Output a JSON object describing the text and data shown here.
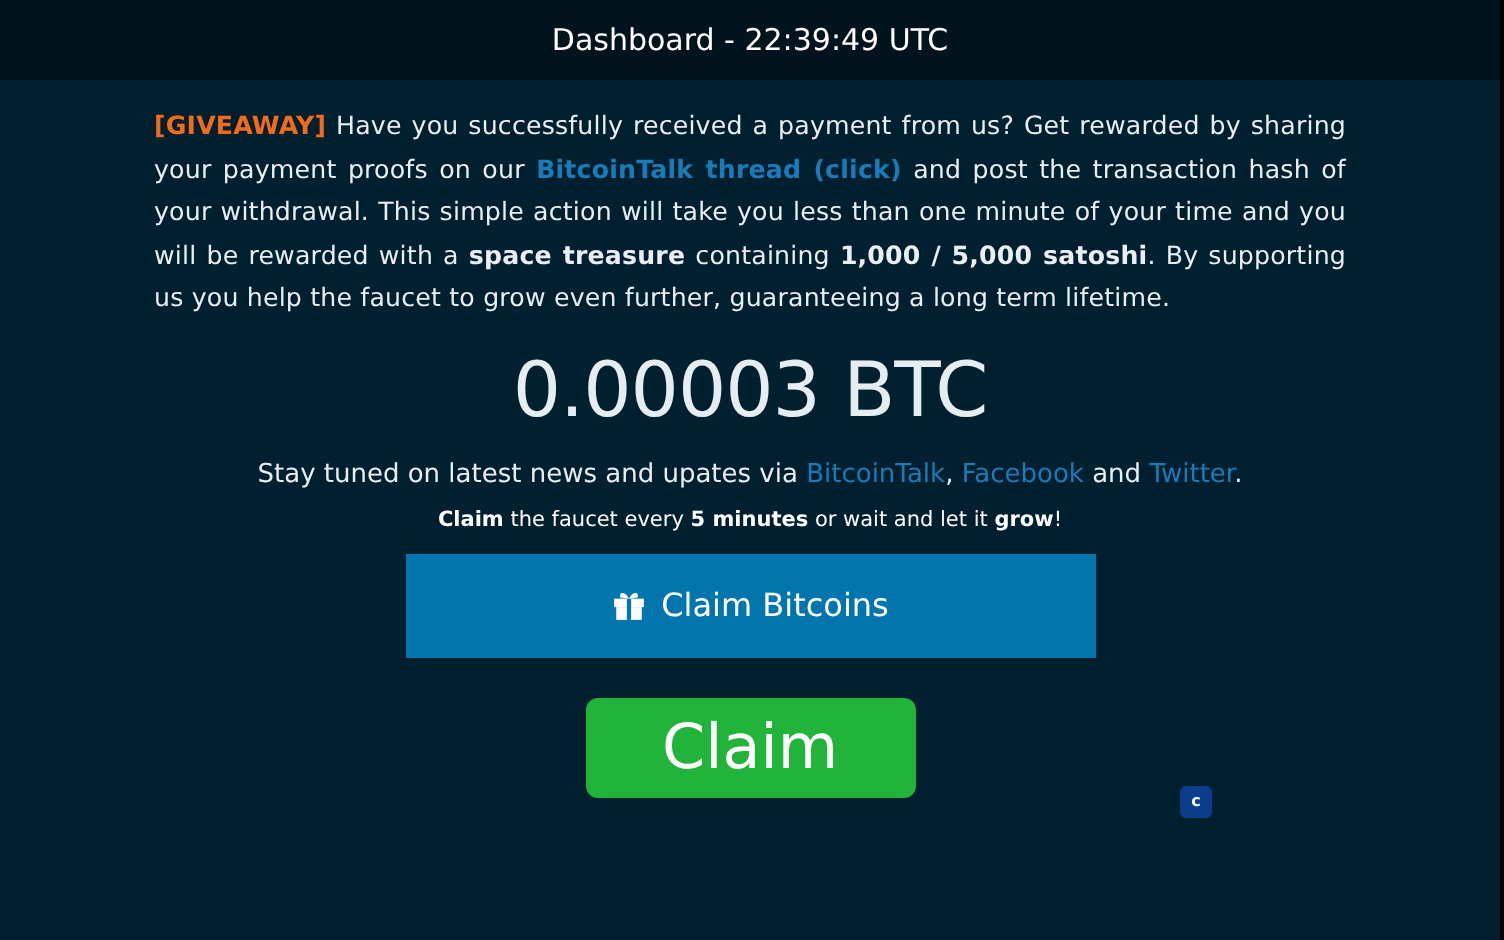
{
  "header": {
    "title": "Dashboard - 22:39:49 UTC"
  },
  "giveaway": {
    "tag": "[GIVEAWAY]",
    "text_before": "Have you successfully received a payment from us? Get rewarded by sharing your payment proofs on our",
    "link": "BitcoinTalk thread (click)",
    "text_after": "and post the transaction hash of your withdrawal. This simple action will take you less than one minute of your time and you will be rewarded with a **space treasure** containing **1,000 / 5,000 satoshi**. By supporting us you help the faucet to grow even further, guaranteeing a long term lifetime."
  },
  "balance": "0.00003 BTC",
  "news": [
    {
      "kind": "text",
      "text": "Stay tuned on latest news and upates via"
    },
    {
      "kind": "link",
      "text": "BitcoinTalk"
    },
    {
      "kind": "text",
      "text": ","
    },
    {
      "kind": "link",
      "text": "Facebook"
    },
    {
      "kind": "text",
      "text": "and"
    },
    {
      "kind": "link",
      "text": "Twitter"
    },
    {
      "kind": "text",
      "text": "."
    }
  ],
  "hint": "**Claim** the faucet every **5 minutes** or wait and let it **grow**!",
  "claim_bitcoins_button": "Claim Bitcoins",
  "claim_button": "Claim",
  "badge": "c"
}
